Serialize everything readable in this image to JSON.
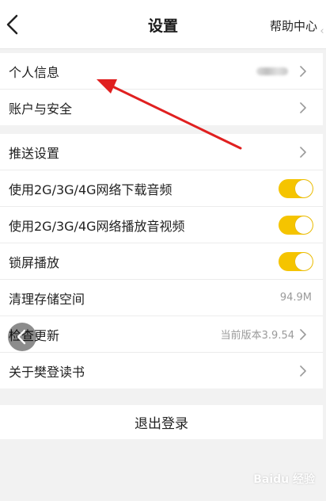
{
  "header": {
    "title": "设置",
    "help_label": "帮助中心"
  },
  "groups": [
    {
      "rows": [
        {
          "label": "个人信息",
          "value": "",
          "control": "chevron",
          "blurred": true
        },
        {
          "label": "账户与安全",
          "value": "",
          "control": "chevron"
        }
      ]
    },
    {
      "rows": [
        {
          "label": "推送设置",
          "control": "chevron"
        },
        {
          "label": "使用2G/3G/4G网络下载音频",
          "control": "toggle",
          "on": true
        },
        {
          "label": "使用2G/3G/4G网络播放音视频",
          "control": "toggle",
          "on": true
        },
        {
          "label": "锁屏播放",
          "control": "toggle",
          "on": true
        },
        {
          "label": "清理存储空间",
          "value": "94.9M",
          "control": "none"
        },
        {
          "label": "检查更新",
          "value": "当前版本3.9.54",
          "control": "chevron"
        },
        {
          "label": "关于樊登读书",
          "control": "chevron"
        }
      ]
    }
  ],
  "logout_label": "退出登录",
  "watermark": "Baidu 经验",
  "colors": {
    "toggle_on": "#f5c400",
    "annotation_arrow": "#e02020"
  },
  "icons": {
    "back": "chevron-left-icon",
    "row_chevron": "chevron-right-icon",
    "floating_back": "chevron-left-icon"
  }
}
